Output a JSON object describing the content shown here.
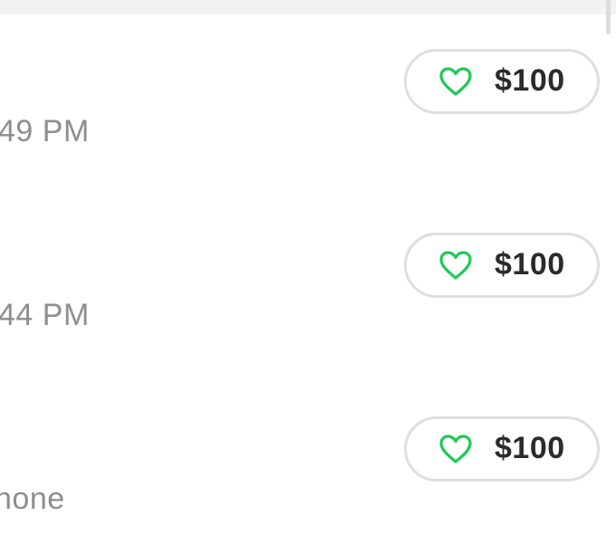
{
  "colors": {
    "heart_green": "#1fc95a",
    "pill_border": "#dedede",
    "subtitle_gray": "#8e8e8e",
    "amount_text": "#2b2b2b",
    "top_bar": "#f2f2f2"
  },
  "transactions": [
    {
      "subtitle": "49 PM",
      "amount": "$100",
      "icon": "heart-icon"
    },
    {
      "subtitle": "44 PM",
      "amount": "$100",
      "icon": "heart-icon"
    },
    {
      "subtitle": "hone",
      "amount": "$100",
      "icon": "heart-icon"
    }
  ]
}
